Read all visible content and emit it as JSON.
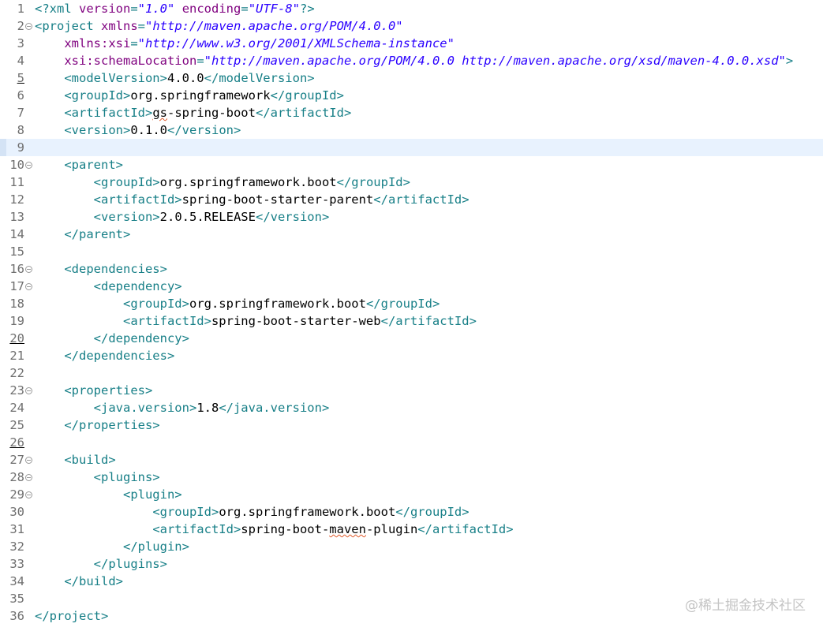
{
  "editor": {
    "current_line": 9,
    "lines": [
      {
        "n": "1",
        "parts": [
          [
            "t",
            "<?xml "
          ],
          [
            "a",
            "version"
          ],
          [
            "t",
            "="
          ],
          [
            "s",
            "\"1.0\""
          ],
          [
            "t",
            " "
          ],
          [
            "a",
            "encoding"
          ],
          [
            "t",
            "="
          ],
          [
            "s",
            "\"UTF-8\""
          ],
          [
            "t",
            "?>"
          ]
        ]
      },
      {
        "n": "2",
        "fold": true,
        "parts": [
          [
            "t",
            "<project "
          ],
          [
            "a",
            "xmlns"
          ],
          [
            "t",
            "="
          ],
          [
            "s",
            "\"http://maven.apache.org/POM/4.0.0\""
          ]
        ]
      },
      {
        "n": "3",
        "parts": [
          [
            "p",
            "    "
          ],
          [
            "a",
            "xmlns:xsi"
          ],
          [
            "t",
            "="
          ],
          [
            "s",
            "\"http://www.w3.org/2001/XMLSchema-instance\""
          ]
        ]
      },
      {
        "n": "4",
        "parts": [
          [
            "p",
            "    "
          ],
          [
            "a",
            "xsi:schemaLocation"
          ],
          [
            "t",
            "="
          ],
          [
            "s",
            "\"http://maven.apache.org/POM/4.0.0 http://maven.apache.org/xsd/maven-4.0.0.xsd\""
          ],
          [
            "t",
            ">"
          ]
        ]
      },
      {
        "n": "5",
        "underline": true,
        "parts": [
          [
            "p",
            "    "
          ],
          [
            "t",
            "<modelVersion>"
          ],
          [
            "p",
            "4.0.0"
          ],
          [
            "t",
            "</modelVersion>"
          ]
        ]
      },
      {
        "n": "6",
        "parts": [
          [
            "p",
            "    "
          ],
          [
            "t",
            "<groupId>"
          ],
          [
            "p",
            "org.springframework"
          ],
          [
            "t",
            "</groupId>"
          ]
        ]
      },
      {
        "n": "7",
        "parts": [
          [
            "p",
            "    "
          ],
          [
            "t",
            "<artifactId>"
          ],
          [
            "w",
            "gs"
          ],
          [
            "p",
            "-spring-boot"
          ],
          [
            "t",
            "</artifactId>"
          ]
        ]
      },
      {
        "n": "8",
        "parts": [
          [
            "p",
            "    "
          ],
          [
            "t",
            "<version>"
          ],
          [
            "p",
            "0.1.0"
          ],
          [
            "t",
            "</version>"
          ]
        ]
      },
      {
        "n": "9",
        "parts": []
      },
      {
        "n": "10",
        "fold": true,
        "parts": [
          [
            "p",
            "    "
          ],
          [
            "t",
            "<parent>"
          ]
        ]
      },
      {
        "n": "11",
        "parts": [
          [
            "p",
            "        "
          ],
          [
            "t",
            "<groupId>"
          ],
          [
            "p",
            "org.springframework.boot"
          ],
          [
            "t",
            "</groupId>"
          ]
        ]
      },
      {
        "n": "12",
        "parts": [
          [
            "p",
            "        "
          ],
          [
            "t",
            "<artifactId>"
          ],
          [
            "p",
            "spring-boot-starter-parent"
          ],
          [
            "t",
            "</artifactId>"
          ]
        ]
      },
      {
        "n": "13",
        "parts": [
          [
            "p",
            "        "
          ],
          [
            "t",
            "<version>"
          ],
          [
            "p",
            "2.0.5.RELEASE"
          ],
          [
            "t",
            "</version>"
          ]
        ]
      },
      {
        "n": "14",
        "parts": [
          [
            "p",
            "    "
          ],
          [
            "t",
            "</parent>"
          ]
        ]
      },
      {
        "n": "15",
        "parts": []
      },
      {
        "n": "16",
        "fold": true,
        "parts": [
          [
            "p",
            "    "
          ],
          [
            "t",
            "<dependencies>"
          ]
        ]
      },
      {
        "n": "17",
        "fold": true,
        "parts": [
          [
            "p",
            "        "
          ],
          [
            "t",
            "<dependency>"
          ]
        ]
      },
      {
        "n": "18",
        "parts": [
          [
            "p",
            "            "
          ],
          [
            "t",
            "<groupId>"
          ],
          [
            "p",
            "org.springframework.boot"
          ],
          [
            "t",
            "</groupId>"
          ]
        ]
      },
      {
        "n": "19",
        "parts": [
          [
            "p",
            "            "
          ],
          [
            "t",
            "<artifactId>"
          ],
          [
            "p",
            "spring-boot-starter-web"
          ],
          [
            "t",
            "</artifactId>"
          ]
        ]
      },
      {
        "n": "20",
        "underline": true,
        "parts": [
          [
            "p",
            "        "
          ],
          [
            "t",
            "</dependency>"
          ]
        ]
      },
      {
        "n": "21",
        "parts": [
          [
            "p",
            "    "
          ],
          [
            "t",
            "</dependencies>"
          ]
        ]
      },
      {
        "n": "22",
        "parts": []
      },
      {
        "n": "23",
        "fold": true,
        "parts": [
          [
            "p",
            "    "
          ],
          [
            "t",
            "<properties>"
          ]
        ]
      },
      {
        "n": "24",
        "parts": [
          [
            "p",
            "        "
          ],
          [
            "t",
            "<java.version>"
          ],
          [
            "p",
            "1.8"
          ],
          [
            "t",
            "</java.version>"
          ]
        ]
      },
      {
        "n": "25",
        "parts": [
          [
            "p",
            "    "
          ],
          [
            "t",
            "</properties>"
          ]
        ]
      },
      {
        "n": "26",
        "underline": true,
        "parts": []
      },
      {
        "n": "27",
        "fold": true,
        "parts": [
          [
            "p",
            "    "
          ],
          [
            "t",
            "<build>"
          ]
        ]
      },
      {
        "n": "28",
        "fold": true,
        "parts": [
          [
            "p",
            "        "
          ],
          [
            "t",
            "<plugins>"
          ]
        ]
      },
      {
        "n": "29",
        "fold": true,
        "parts": [
          [
            "p",
            "            "
          ],
          [
            "t",
            "<plugin>"
          ]
        ]
      },
      {
        "n": "30",
        "parts": [
          [
            "p",
            "                "
          ],
          [
            "t",
            "<groupId>"
          ],
          [
            "p",
            "org.springframework.boot"
          ],
          [
            "t",
            "</groupId>"
          ]
        ]
      },
      {
        "n": "31",
        "parts": [
          [
            "p",
            "                "
          ],
          [
            "t",
            "<artifactId>"
          ],
          [
            "p",
            "spring-boot-"
          ],
          [
            "w",
            "maven"
          ],
          [
            "p",
            "-plugin"
          ],
          [
            "t",
            "</artifactId>"
          ]
        ]
      },
      {
        "n": "32",
        "parts": [
          [
            "p",
            "            "
          ],
          [
            "t",
            "</plugin>"
          ]
        ]
      },
      {
        "n": "33",
        "parts": [
          [
            "p",
            "        "
          ],
          [
            "t",
            "</plugins>"
          ]
        ]
      },
      {
        "n": "34",
        "parts": [
          [
            "p",
            "    "
          ],
          [
            "t",
            "</build>"
          ]
        ]
      },
      {
        "n": "35",
        "parts": []
      },
      {
        "n": "36",
        "parts": [
          [
            "t",
            "</project>"
          ]
        ]
      }
    ]
  },
  "watermark": "@稀土掘金技术社区"
}
